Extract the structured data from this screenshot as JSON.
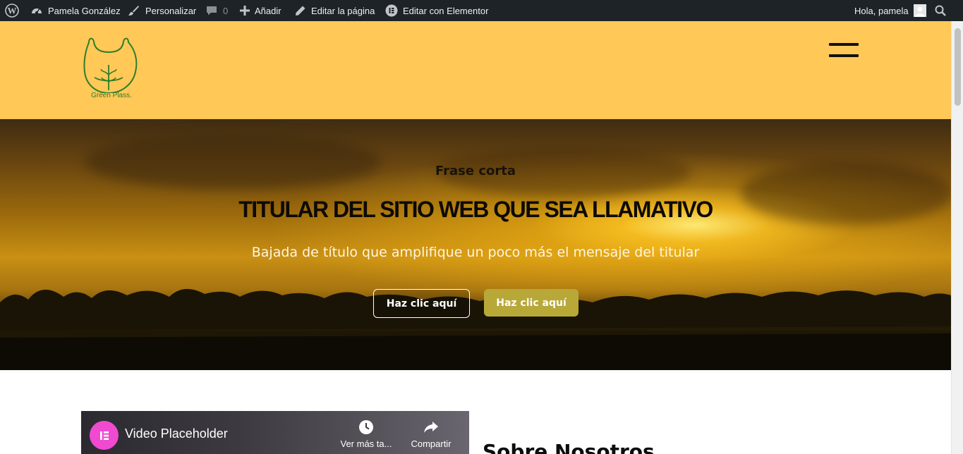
{
  "admin_bar": {
    "site_name": "Pamela González",
    "customize": "Personalizar",
    "comments_count": "0",
    "add_new": "Añadir",
    "edit_page": "Editar la página",
    "edit_elementor": "Editar con Elementor",
    "greeting": "Hola, pamela"
  },
  "header": {
    "logo_text": "Green Plass.",
    "bg_color": "#ffc857"
  },
  "hero": {
    "kicker": "Frase corta",
    "headline": "TITULAR DEL SITIO WEB QUE SEA LLAMATIVO",
    "subline": "Bajada de título que amplifique un poco más el mensaje del titular",
    "button_primary": "Haz clic aquí",
    "button_secondary": "Haz clic aquí",
    "accent_color": "#b8a838"
  },
  "video": {
    "title": "Video Placeholder",
    "watch_later": "Ver más ta...",
    "share": "Compartir"
  },
  "about": {
    "title": "Sobre Nosotros"
  }
}
